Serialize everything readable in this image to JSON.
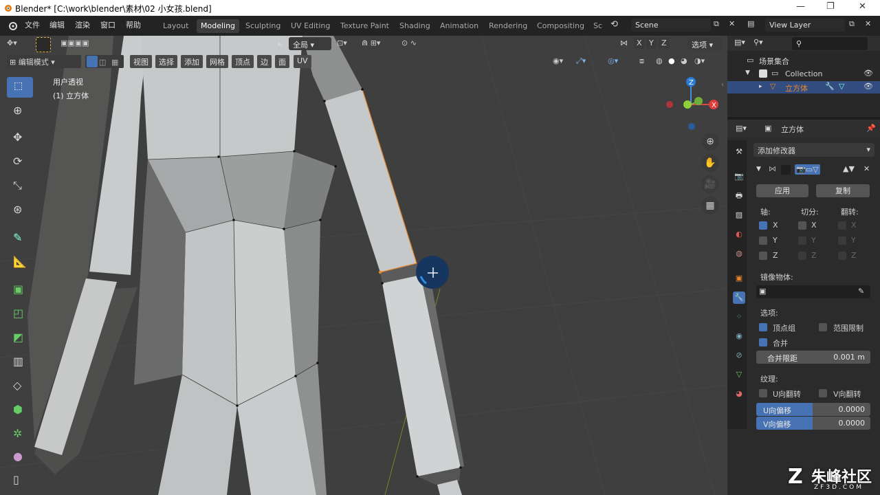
{
  "window": {
    "title": "Blender* [C:\\work\\blender\\素材\\02 小女孩.blend]",
    "minimize": "—",
    "restore": "❐",
    "close": "✕"
  },
  "menus": [
    "文件",
    "编辑",
    "渲染",
    "窗口",
    "帮助"
  ],
  "workspaces": [
    "Layout",
    "Modeling",
    "Sculpting",
    "UV Editing",
    "Texture Paint",
    "Shading",
    "Animation",
    "Rendering",
    "Compositing",
    "Sc"
  ],
  "active_workspace": "Modeling",
  "scene": {
    "label": "Scene",
    "view_layer": "View Layer"
  },
  "viewport": {
    "transform_orient": "全局",
    "options_label": "选项",
    "mode": "编辑模式",
    "header_menus": [
      "视图",
      "选择",
      "添加",
      "网格",
      "顶点",
      "边",
      "面",
      "UV"
    ],
    "view_name": "用户透视",
    "object_name": "(1) 立方体",
    "axes": {
      "x": "X",
      "y": "Y",
      "z": "Z"
    }
  },
  "outliner": {
    "root": "场景集合",
    "collection": "Collection",
    "object": "立方体"
  },
  "properties": {
    "object_name": "立方体",
    "add_modifier": "添加修改器",
    "apply": "应用",
    "copy": "复制",
    "axis_label": "轴:",
    "bisect_label": "切分:",
    "flip_label": "翻转:",
    "axis_x": "X",
    "axis_y": "Y",
    "axis_z": "Z",
    "mirror_object_label": "镜像物体:",
    "options_label": "选项:",
    "vertex_groups": "顶点组",
    "clipping": "范围限制",
    "merge": "合并",
    "merge_limit_label": "合并限距",
    "merge_limit_value": "0.001 m",
    "texture_label": "纹理:",
    "u_flip": "U向翻转",
    "v_flip": "V向翻转",
    "u_offset_label": "U向偏移",
    "u_offset_value": "0.0000",
    "v_offset_label": "V向偏移",
    "v_offset_value": "0.0000"
  },
  "watermark": {
    "main": "朱峰社区",
    "sub": "ZF3D.COM"
  },
  "colors": {
    "accent": "#4772b3",
    "viewport_bg": "#3f3f3f",
    "mesh_face": "#c8cbcb",
    "selected_edge": "#e8862a"
  }
}
